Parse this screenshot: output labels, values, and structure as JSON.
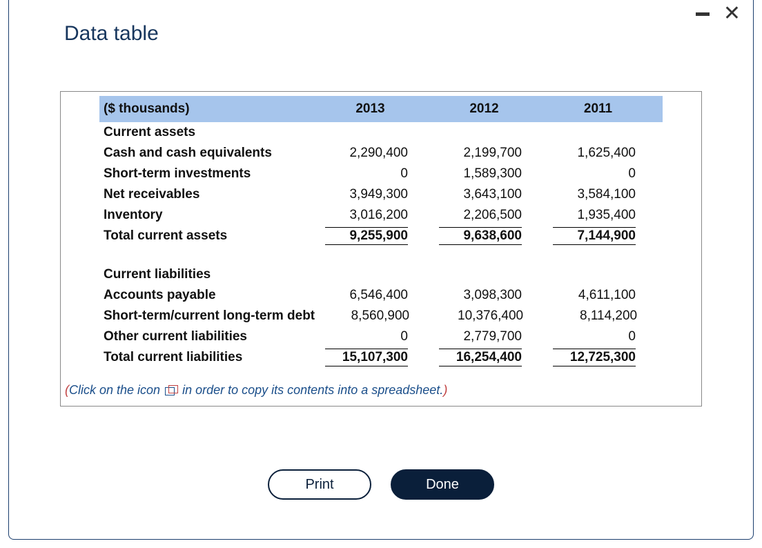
{
  "title": "Data table",
  "columns": {
    "unit": "($ thousands)",
    "y1": "2013",
    "y2": "2012",
    "y3": "2011"
  },
  "assets_heading": "Current assets",
  "rows_assets": {
    "cash": {
      "label": "Cash and cash equivalents",
      "y1": "2,290,400",
      "y2": "2,199,700",
      "y3": "1,625,400"
    },
    "sti": {
      "label": "Short-term investments",
      "y1": "0",
      "y2": "1,589,300",
      "y3": "0"
    },
    "recv": {
      "label": "Net receivables",
      "y1": "3,949,300",
      "y2": "3,643,100",
      "y3": "3,584,100"
    },
    "inv": {
      "label": "Inventory",
      "y1": "3,016,200",
      "y2": "2,206,500",
      "y3": "1,935,400"
    },
    "total": {
      "label": "Total current assets",
      "y1": "9,255,900",
      "y2": "9,638,600",
      "y3": "7,144,900"
    }
  },
  "liab_heading": "Current liabilities",
  "rows_liab": {
    "ap": {
      "label": "Accounts payable",
      "y1": "6,546,400",
      "y2": "3,098,300",
      "y3": "4,611,100"
    },
    "debt": {
      "label": "Short-term/current long-term debt",
      "y1": "8,560,900",
      "y2": "10,376,400",
      "y3": "8,114,200"
    },
    "other": {
      "label": "Other current liabilities",
      "y1": "0",
      "y2": "2,779,700",
      "y3": "0"
    },
    "total": {
      "label": "Total current liabilities",
      "y1": "15,107,300",
      "y2": "16,254,400",
      "y3": "12,725,300"
    }
  },
  "hint": {
    "open": "(",
    "pre": "Click on the icon ",
    "post": " in order to copy its contents into a spreadsheet.",
    "close": ")"
  },
  "buttons": {
    "print": "Print",
    "done": "Done"
  },
  "chart_data": {
    "type": "table",
    "unit": "$ thousands",
    "columns": [
      "2013",
      "2012",
      "2011"
    ],
    "sections": [
      {
        "name": "Current assets",
        "rows": [
          {
            "label": "Cash and cash equivalents",
            "values": [
              2290400,
              2199700,
              1625400
            ]
          },
          {
            "label": "Short-term investments",
            "values": [
              0,
              1589300,
              0
            ]
          },
          {
            "label": "Net receivables",
            "values": [
              3949300,
              3643100,
              3584100
            ]
          },
          {
            "label": "Inventory",
            "values": [
              3016200,
              2206500,
              1935400
            ]
          }
        ],
        "total": {
          "label": "Total current assets",
          "values": [
            9255900,
            9638600,
            7144900
          ]
        }
      },
      {
        "name": "Current liabilities",
        "rows": [
          {
            "label": "Accounts payable",
            "values": [
              6546400,
              3098300,
              4611100
            ]
          },
          {
            "label": "Short-term/current long-term debt",
            "values": [
              8560900,
              10376400,
              8114200
            ]
          },
          {
            "label": "Other current liabilities",
            "values": [
              0,
              2779700,
              0
            ]
          }
        ],
        "total": {
          "label": "Total current liabilities",
          "values": [
            15107300,
            16254400,
            12725300
          ]
        }
      }
    ]
  }
}
